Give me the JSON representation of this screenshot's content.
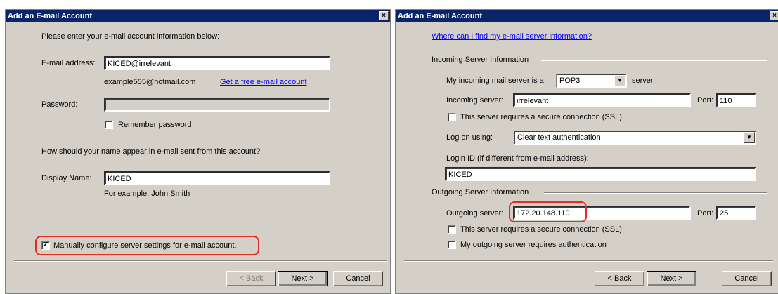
{
  "left": {
    "title": "Add an E-mail Account",
    "close": "×",
    "intro": "Please enter your e-mail account information below:",
    "email_label": "E-mail address:",
    "email_value": "KICED@irrelevant",
    "email_example": "example555@hotmail.com",
    "free_link": "Get a free e-mail account",
    "password_label": "Password:",
    "password_value": "",
    "remember_label": "Remember password",
    "name_question": "How should your name appear in e-mail sent from this account?",
    "display_label": "Display Name:",
    "display_value": "KICED",
    "display_example": "For example: John Smith",
    "manual_label": "Manually configure server settings for e-mail account.",
    "manual_checked": "✓",
    "back": "< Back",
    "next": "Next >",
    "cancel": "Cancel"
  },
  "right": {
    "title": "Add an E-mail Account",
    "close": "×",
    "where_link": "Where can I find my e-mail server information?",
    "incoming_section": "Incoming Server Information",
    "server_type_label": "My incoming mail server is a",
    "server_type_value": "POP3",
    "server_suffix": "server.",
    "incoming_label": "Incoming server:",
    "incoming_value": "irrelevant",
    "port_label": "Port:",
    "incoming_port": "110",
    "ssl_in_label": "This server requires a secure connection (SSL)",
    "logon_label": "Log on using:",
    "logon_value": "Clear text authentication",
    "login_id_label": "Login ID (if different from e-mail address):",
    "login_id_value": "KICED",
    "outgoing_section": "Outgoing Server Information",
    "outgoing_label": "Outgoing server:",
    "outgoing_value": "172.20.148.110",
    "outgoing_port": "25",
    "ssl_out_label": "This server requires a secure connection (SSL)",
    "auth_label": "My outgoing server requires authentication",
    "back": "< Back",
    "next": "Next >",
    "cancel": "Cancel"
  },
  "colors": {
    "title_bg": "#0a246a",
    "dialog_bg": "#d4d0c8",
    "highlight": "#e52b22",
    "link": "#0000ff"
  }
}
